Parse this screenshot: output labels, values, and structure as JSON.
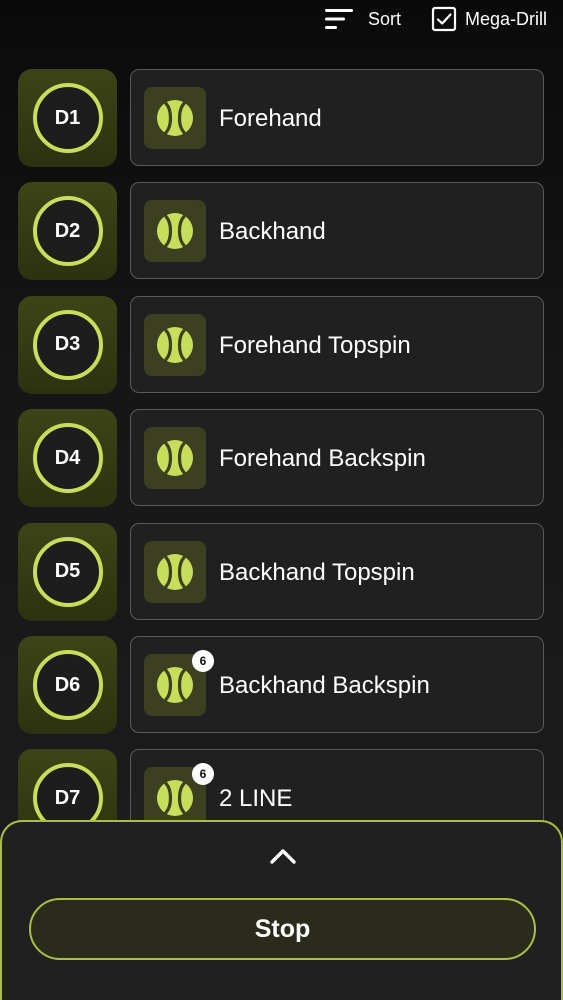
{
  "toolbar": {
    "sort_label": "Sort",
    "mega_drill_label": "Mega-Drill",
    "mega_drill_checked": true
  },
  "drills": [
    {
      "badge": "D1",
      "name": "Forehand",
      "count": null
    },
    {
      "badge": "D2",
      "name": "Backhand",
      "count": null
    },
    {
      "badge": "D3",
      "name": "Forehand Topspin",
      "count": null
    },
    {
      "badge": "D4",
      "name": "Forehand Backspin",
      "count": null
    },
    {
      "badge": "D5",
      "name": "Backhand Topspin",
      "count": null
    },
    {
      "badge": "D6",
      "name": "Backhand Backspin",
      "count": "6"
    },
    {
      "badge": "D7",
      "name": "2 LINE",
      "count": "6"
    }
  ],
  "panel": {
    "stop_label": "Stop"
  },
  "icons": {
    "sort": "sort-lines-icon",
    "checkbox": "checkbox-checked-icon",
    "ball": "tennis-ball-icon",
    "chevron": "chevron-up-icon"
  },
  "colors": {
    "accent": "#c7de5a",
    "accent_border": "#a8bf44",
    "badge_bg": "#3d4417",
    "card_bg": "#202020",
    "ball_tile_bg": "#3c4020"
  }
}
